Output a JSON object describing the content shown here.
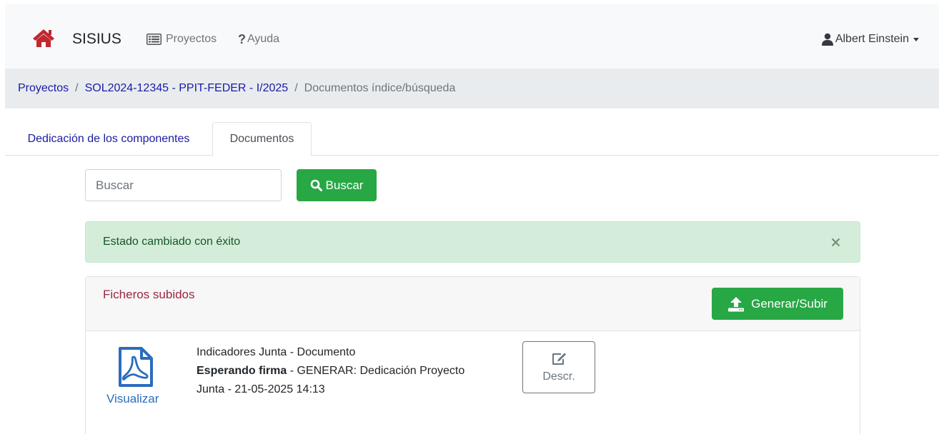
{
  "navbar": {
    "brand": "SISIUS",
    "projects_label": "Proyectos",
    "help_label": "Ayuda",
    "help_glyph": "?",
    "user_name": "Albert Einstein",
    "home_icon_color": "#c0282e"
  },
  "breadcrumb": {
    "items": [
      "Proyectos",
      "SOL2024-12345 - PPIT-FEDER - I/2025"
    ],
    "current": "Documentos índice/búsqueda",
    "separator": "/"
  },
  "tabs": [
    {
      "label": "Dedicación de los componentes",
      "active": false
    },
    {
      "label": "Documentos",
      "active": true
    }
  ],
  "search": {
    "placeholder": "Buscar",
    "button_label": "Buscar"
  },
  "alert": {
    "message": "Estado cambiado con éxito",
    "close_glyph": "×"
  },
  "files_card": {
    "title": "Ficheros subidos",
    "generate_button_label": "Generar/Subir",
    "documents": [
      {
        "name": "Indicadores Junta - Documento",
        "state": "Esperando firma",
        "detail_line1": " - GENERAR: Dedicación Proyecto",
        "detail_line2": "Junta - 21-05-2025 14:13",
        "view_label": "Visualizar",
        "descr_label": "Descr."
      }
    ]
  },
  "colors": {
    "success": "#28a745",
    "link": "#1a1aa6",
    "card_title": "#9b2743",
    "pdf_icon": "#2a6dbd"
  }
}
